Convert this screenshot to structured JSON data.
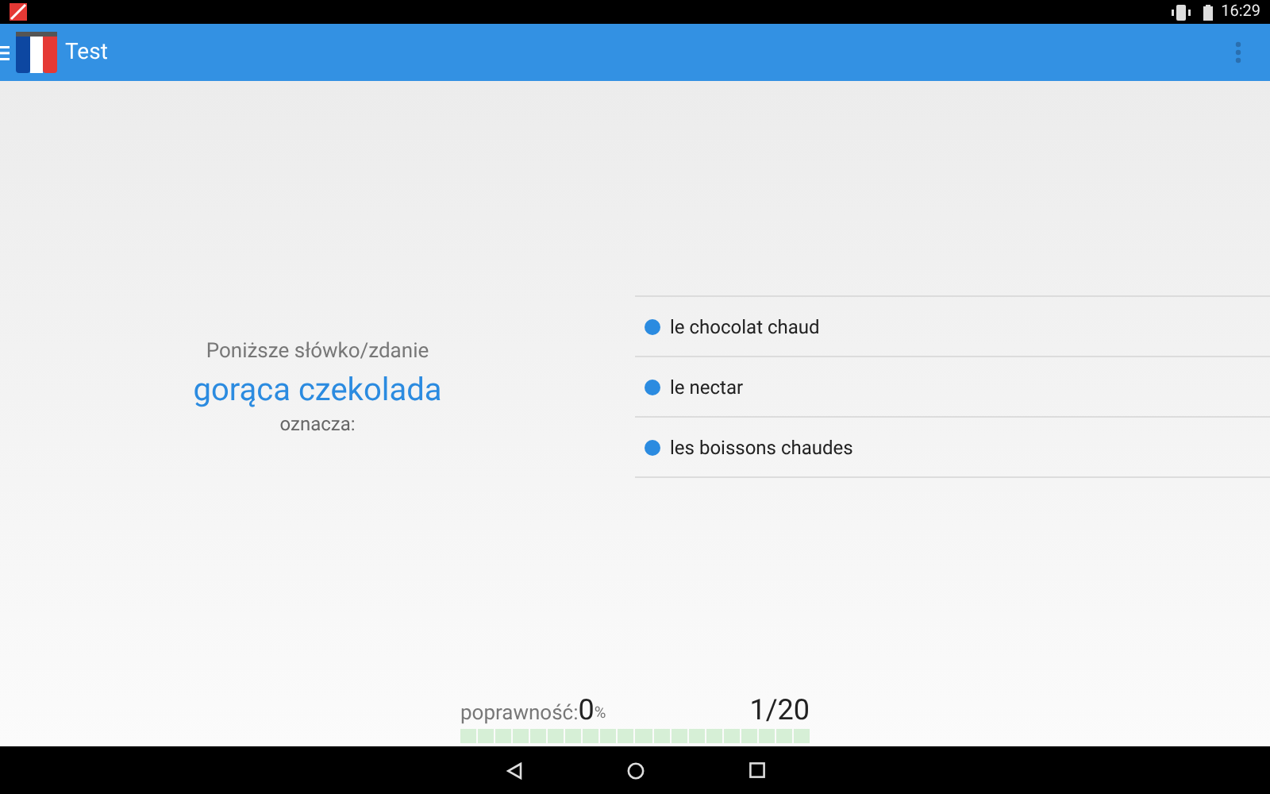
{
  "status_bar": {
    "time": "16:29"
  },
  "app_bar": {
    "title": "Test"
  },
  "question": {
    "intro": "Poniższe słówko/zdanie",
    "word": "gorąca czekolada",
    "suffix": "oznacza:"
  },
  "answers": [
    {
      "label": "le chocolat chaud"
    },
    {
      "label": "le nectar"
    },
    {
      "label": "les boissons chaudes"
    }
  ],
  "footer": {
    "label": "poprawność:",
    "score": "0",
    "unit": "%",
    "counter": "1/20"
  }
}
